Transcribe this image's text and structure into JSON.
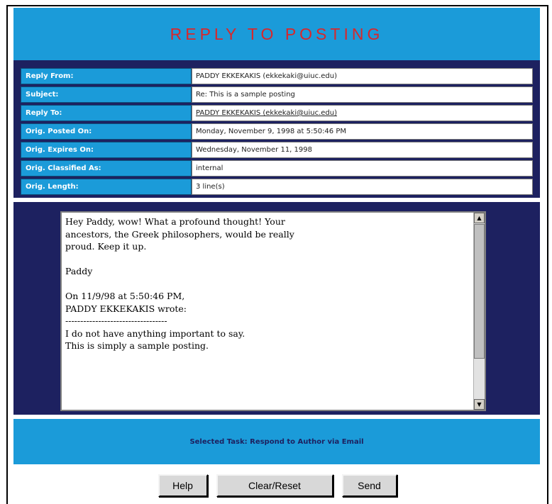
{
  "title": "REPLY TO POSTING",
  "info": {
    "rows": [
      {
        "label": "Reply From:",
        "value": "PADDY EKKEKAKIS (ekkekaki@uiuc.edu)"
      },
      {
        "label": "Subject:",
        "value": "Re: This is a sample posting"
      },
      {
        "label": "Reply To:",
        "value": "PADDY EKKEKAKIS (ekkekaki@uiuc.edu)"
      },
      {
        "label": "Orig. Posted On:",
        "value": "Monday, November 9, 1998 at 5:50:46 PM"
      },
      {
        "label": "Orig. Expires On:",
        "value": "Wednesday, November 11, 1998"
      },
      {
        "label": "Orig. Classified As:",
        "value": "internal"
      },
      {
        "label": "Orig. Length:",
        "value": "3 line(s)"
      }
    ]
  },
  "message": {
    "body": "Hey Paddy, wow! What a profound thought! Your\nancestors, the Greek philosophers, would be really\nproud. Keep it up.\n\nPaddy\n\nOn 11/9/98 at 5:50:46 PM,\nPADDY EKKEKAKIS wrote:\n----------------------------------\nI do not have anything important to say.\nThis is simply a sample posting."
  },
  "task": {
    "text": "Selected Task: Respond to Author via Email"
  },
  "buttons": {
    "help": "Help",
    "clear": "Clear/Reset",
    "send": "Send"
  },
  "colors": {
    "accent": "#1b9bd9",
    "panel": "#1d2160",
    "title": "#d8272b"
  },
  "icons": {
    "scroll_up": "scroll-up-arrow-icon",
    "scroll_down": "scroll-down-arrow-icon"
  }
}
